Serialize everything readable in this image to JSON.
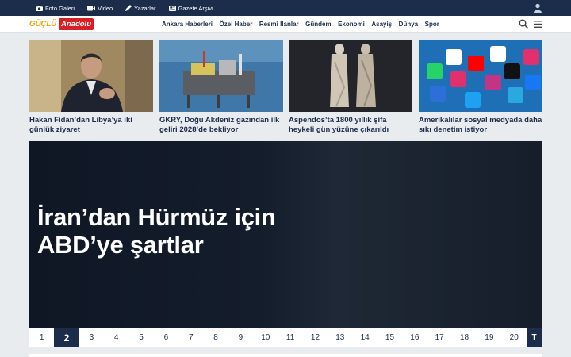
{
  "topbar": {
    "links": [
      {
        "label": "Foto Galeri",
        "icon": "camera-icon"
      },
      {
        "label": "Video",
        "icon": "video-camera-icon"
      },
      {
        "label": "Yazarlar",
        "icon": "pen-icon"
      },
      {
        "label": "Gazete Arşivi",
        "icon": "newspaper-icon"
      }
    ],
    "user_icon": "user-icon"
  },
  "logo": {
    "part1": "GÜÇLÜ",
    "part2": "Anadolu"
  },
  "menu": [
    "Ankara Haberleri",
    "Özel Haber",
    "Resmî İlanlar",
    "Gündem",
    "Ekonomi",
    "Asayiş",
    "Dünya",
    "Spor"
  ],
  "cards": [
    {
      "title": "Hakan Fidan’dan Libya’ya iki günlük ziyaret"
    },
    {
      "title": "GKRY, Doğu Akdeniz gazından ilk geliri 2028’de bekliyor"
    },
    {
      "title": "Aspendos’ta 1800 yıllık şifa heykeli gün yüzüne çıkarıldı"
    },
    {
      "title": "Amerikalılar sosyal medyada daha sıkı denetim istiyor"
    }
  ],
  "headline": {
    "title": "İran’dan Hürmüz için ABD’ye şartlar"
  },
  "pagination": {
    "pages": [
      "1",
      "2",
      "3",
      "4",
      "5",
      "6",
      "7",
      "8",
      "9",
      "10",
      "11",
      "12",
      "13",
      "14",
      "15",
      "16",
      "17",
      "18",
      "19",
      "20"
    ],
    "active": "2",
    "extra": "T"
  },
  "colors": {
    "primary": "#1b2d4b",
    "logo_yellow": "#f0a700",
    "logo_red": "#d81f26"
  }
}
